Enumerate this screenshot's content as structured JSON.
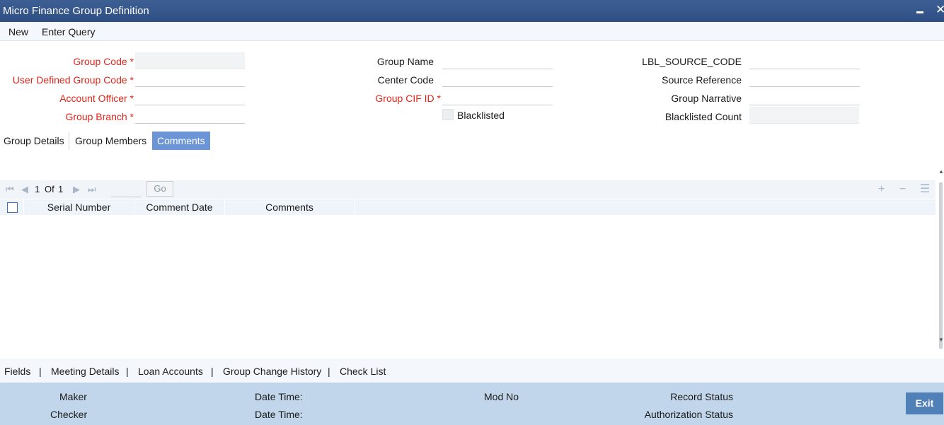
{
  "window": {
    "title": "Micro Finance Group Definition"
  },
  "menu": {
    "new": "New",
    "enter_query": "Enter Query"
  },
  "form": {
    "group_code": {
      "label": "Group Code *",
      "value": ""
    },
    "user_defined_group_code": {
      "label": "User Defined Group Code *",
      "value": ""
    },
    "account_officer": {
      "label": "Account Officer *",
      "value": ""
    },
    "group_branch": {
      "label": "Group Branch *",
      "value": ""
    },
    "group_name": {
      "label": "Group Name",
      "value": ""
    },
    "center_code": {
      "label": "Center Code",
      "value": ""
    },
    "group_cif_id": {
      "label": "Group CIF ID *",
      "value": ""
    },
    "blacklisted": {
      "label": "Blacklisted",
      "checked": false
    },
    "source_code": {
      "label": "LBL_SOURCE_CODE",
      "value": ""
    },
    "source_reference": {
      "label": "Source Reference",
      "value": ""
    },
    "group_narrative": {
      "label": "Group Narrative",
      "value": ""
    },
    "blacklisted_count": {
      "label": "Blacklisted Count",
      "value": ""
    }
  },
  "tabs": [
    {
      "label": "Group Details",
      "active": false
    },
    {
      "label": "Group Members",
      "active": false
    },
    {
      "label": "Comments",
      "active": true
    }
  ],
  "grid": {
    "pagination": {
      "page": "1",
      "of_label": "Of",
      "total": "1",
      "go_label": "Go",
      "page_input": ""
    },
    "columns": [
      "Serial Number",
      "Comment Date",
      "Comments"
    ],
    "rows": []
  },
  "footer_links": [
    "Fields",
    "Meeting Details",
    "Loan Accounts",
    "Group Change History",
    "Check List"
  ],
  "footer_separator": "|",
  "audit": {
    "maker": "Maker",
    "checker": "Checker",
    "date_time_1": "Date Time:",
    "date_time_2": "Date Time:",
    "mod_no": "Mod No",
    "record_status": "Record Status",
    "authorization_status": "Authorization Status"
  },
  "buttons": {
    "exit": "Exit"
  },
  "colors": {
    "title_bar": "#2e4f84",
    "required_label": "#e0261b",
    "active_tab": "#6c95d6",
    "audit_panel": "#c1d6ea",
    "exit_button": "#4f80b8"
  }
}
